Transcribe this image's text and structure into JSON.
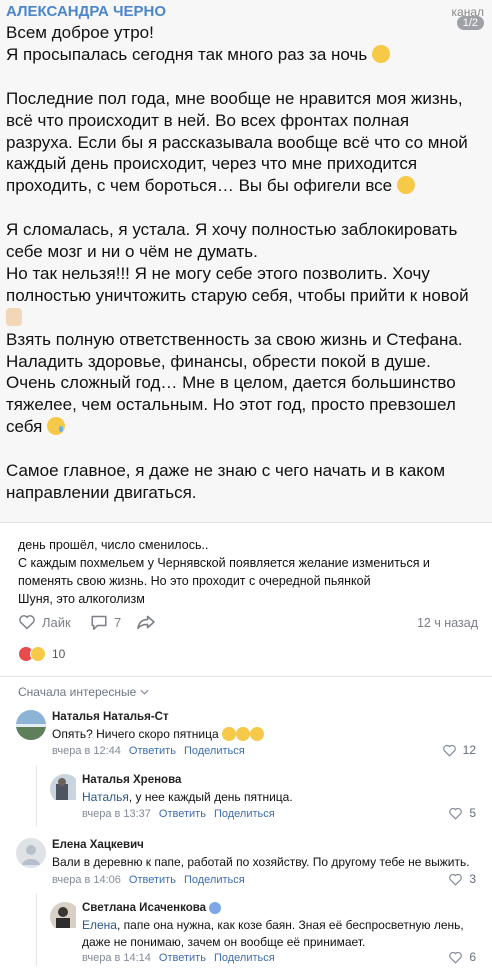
{
  "post_image": {
    "author": "АЛЕКСАНДРА ЧЕРНО",
    "channel_label": "канал",
    "page_badge": "1/2",
    "lines": [
      {
        "text": "Всем доброе утро!"
      },
      {
        "text": "Я просыпалась сегодня так много раз за ночь",
        "emoji": "rolling-eyes-emoji"
      },
      {
        "text": ""
      },
      {
        "text": "Последние пол года, мне вообще не нравится моя жизнь,"
      },
      {
        "text": "всё что происходит в ней. Во всех фронтах полная"
      },
      {
        "text": "разруха. Если бы я рассказывала вообще всё что со мной"
      },
      {
        "text": "каждый день происходит, через что мне приходится"
      },
      {
        "text": "проходить, с чем бороться… Вы бы офигели все",
        "emoji": "exploding-head-emoji"
      },
      {
        "text": ""
      },
      {
        "text": "Я сломалась, я устала. Я хочу полностью заблокировать"
      },
      {
        "text": "себе мозг и ни о чём не думать."
      },
      {
        "text": "Но так нельзя!!! Я не могу себе этого позволить. Хочу"
      },
      {
        "text": "полностью уничтожить старую себя, чтобы прийти к новой"
      },
      {
        "text": "",
        "emoji": "praying-hands-emoji"
      },
      {
        "text": "Взять полную ответственность за свою жизнь и Стефана."
      },
      {
        "text": "Наладить здоровье, финансы, обрести покой в душе."
      },
      {
        "text": "Очень сложный год… Мне в целом, дается большинство"
      },
      {
        "text": "тяжелее, чем остальным. Но этот год, просто превзошел"
      },
      {
        "text": "себя",
        "emoji": "crying-face-emoji"
      },
      {
        "text": ""
      },
      {
        "text": "Самое главное, я даже не знаю с чего начать и в каком"
      },
      {
        "text": "направлении двигаться."
      }
    ]
  },
  "caption": {
    "lines": [
      "день прошёл, число сменилось..",
      "С каждым похмельем у Чернявской появляется желание измениться и",
      "поменять свою жизнь. Но это проходит с очередной пьянкой",
      "Шуня, это алкоголизм"
    ]
  },
  "actions": {
    "like_label": "Лайк",
    "comments_count": "7",
    "time_ago": "12 ч назад"
  },
  "reactions": {
    "count": "10",
    "colors": {
      "heart": "#e74b4b",
      "laugh": "#f7c948"
    }
  },
  "sort": {
    "label": "Сначала интересные"
  },
  "comments": [
    {
      "author": "Наталья Наталья-Ст",
      "text": "Опять? Ничего скоро пятница",
      "emoji": "rolling-laughing-emoji x3",
      "time": "вчера в 12:44",
      "reply": "Ответить",
      "share": "Поделиться",
      "likes": "12"
    },
    {
      "author": "Наталья Хренова",
      "mention": "Наталья",
      "text": ", у нее каждый день пятница.",
      "time": "вчера в 13:37",
      "reply": "Ответить",
      "share": "Поделиться",
      "likes": "5"
    },
    {
      "author": "Елена Хацкевич",
      "text": "Вали в деревню к папе, работай по хозяйству. По другому тебе не выжить.",
      "time": "вчера в 14:06",
      "reply": "Ответить",
      "share": "Поделиться",
      "likes": "3"
    },
    {
      "author": "Светлана Исаченкова",
      "mention": "Елена",
      "text": ", папе она нужна, как козе баян. Зная её беспросветную лень,",
      "text2": "даже не понимаю, зачем он вообще её принимает.",
      "time": "вчера в 14:14",
      "reply": "Ответить",
      "share": "Поделиться",
      "likes": "6"
    }
  ]
}
